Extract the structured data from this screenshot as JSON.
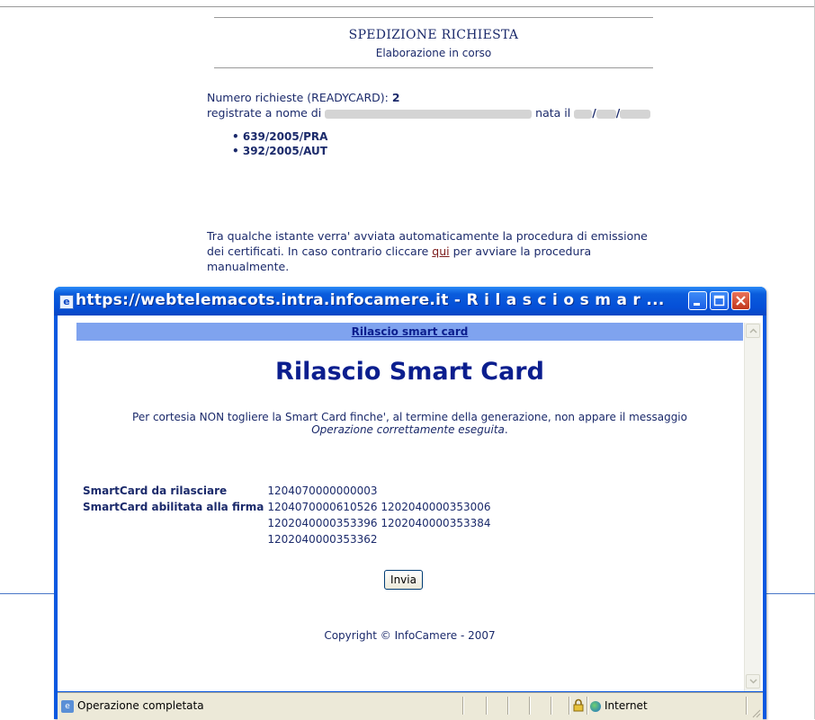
{
  "background_page": {
    "title": "SPEDIZIONE RICHIESTA",
    "subtitle": "Elaborazione in corso",
    "requests_label": "Numero richieste (READYCARD):",
    "requests_count": "2",
    "registered_prefix": "registrate a nome di",
    "born_label": "nata il",
    "requests": [
      "639/2005/PRA",
      "392/2005/AUT"
    ],
    "paragraph_before_link": "Tra qualche istante verra' avviata automaticamente la procedura di emissione dei certificati. In caso contrario cliccare ",
    "link_text": "qui",
    "paragraph_after_link": " per avviare la procedura manualmente."
  },
  "popup": {
    "title": "https://webtelemacots.intra.infocamere.it - R i l a s c i o   s m a r ...",
    "nav_link": "Rilascio smart card",
    "heading": "Rilascio Smart Card",
    "notice": "Per cortesia NON togliere la Smart Card finche', al termine della generazione, non appare il messaggio",
    "notice_italic": "Operazione correttamente eseguita",
    "notice_end": ".",
    "card_release_label": "SmartCard da rilasciare",
    "card_release_value": "1204070000000003",
    "card_sign_label": "SmartCard abilitata alla firma",
    "card_sign_line1": "1204070000610526 1202040000353006",
    "card_sign_line2": "1202040000353396 1202040000353384",
    "card_sign_line3": "1202040000353362",
    "submit_label": "Invia",
    "copyright": "Copyright © InfoCamere - 2007"
  },
  "statusbar": {
    "status_text": "Operazione completata",
    "zone": "Internet"
  },
  "icons": {
    "ie_page": "ie-page-icon",
    "minimize": "minimize-icon",
    "maximize": "maximize-icon",
    "close": "close-icon",
    "lock": "lock-icon",
    "globe": "globe-icon"
  },
  "colors": {
    "text": "#1b2a6b",
    "titlebar": "#0550d8",
    "nav_bar": "#7fa3ef",
    "close_button": "#c2371c",
    "link": "#7b1a1a"
  }
}
